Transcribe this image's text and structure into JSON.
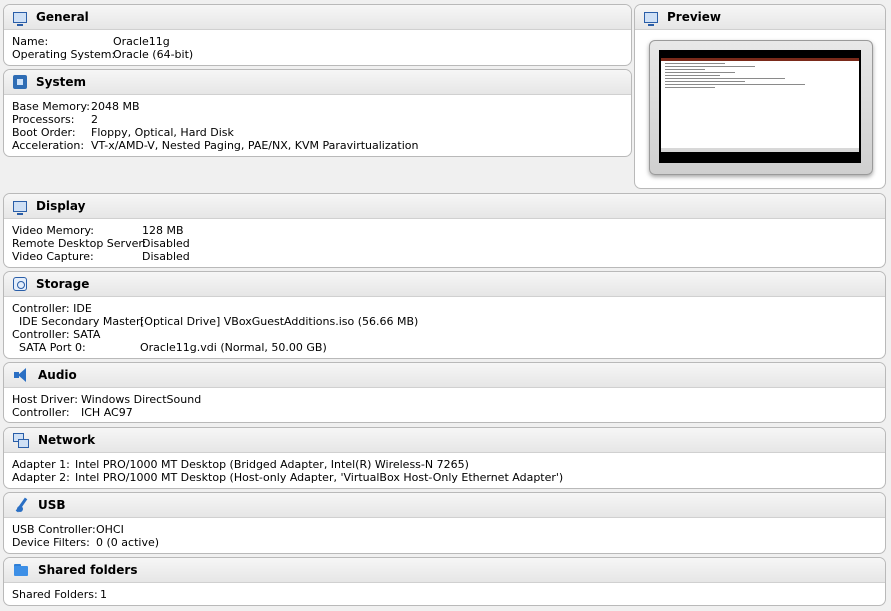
{
  "general": {
    "title": "General",
    "icon": "monitor-icon",
    "rows": [
      {
        "k": "Name:",
        "v": "Oracle11g"
      },
      {
        "k": "Operating System:",
        "v": "Oracle (64-bit)"
      }
    ]
  },
  "system": {
    "title": "System",
    "icon": "chip-icon",
    "rows": [
      {
        "k": "Base Memory:",
        "v": "2048 MB"
      },
      {
        "k": "Processors:",
        "v": "2"
      },
      {
        "k": "Boot Order:",
        "v": "Floppy, Optical, Hard Disk"
      },
      {
        "k": "Acceleration:",
        "v": "VT-x/AMD-V, Nested Paging, PAE/NX, KVM Paravirtualization"
      }
    ]
  },
  "preview": {
    "title": "Preview",
    "icon": "monitor-icon"
  },
  "display": {
    "title": "Display",
    "icon": "monitor-icon",
    "rows": [
      {
        "k": "Video Memory:",
        "v": "128 MB"
      },
      {
        "k": "Remote Desktop Server:",
        "v": "Disabled"
      },
      {
        "k": "Video Capture:",
        "v": "Disabled"
      }
    ]
  },
  "storage": {
    "title": "Storage",
    "icon": "disk-icon",
    "rows": [
      {
        "k": "Controller: IDE",
        "v": ""
      },
      {
        "k": "  IDE Secondary Master:",
        "v": "[Optical Drive] VBoxGuestAdditions.iso (56.66 MB)"
      },
      {
        "k": "Controller: SATA",
        "v": ""
      },
      {
        "k": "  SATA Port 0:",
        "v": "Oracle11g.vdi (Normal, 50.00 GB)"
      }
    ]
  },
  "audio": {
    "title": "Audio",
    "icon": "speaker-icon",
    "rows": [
      {
        "k": "Host Driver:",
        "v": "Windows DirectSound"
      },
      {
        "k": "Controller:",
        "v": "ICH AC97"
      }
    ]
  },
  "network": {
    "title": "Network",
    "icon": "network-icon",
    "rows": [
      {
        "k": "Adapter 1:",
        "v": "Intel PRO/1000 MT Desktop (Bridged Adapter, Intel(R) Wireless-N 7265)"
      },
      {
        "k": "Adapter 2:",
        "v": "Intel PRO/1000 MT Desktop (Host-only Adapter, 'VirtualBox Host-Only Ethernet Adapter')"
      }
    ]
  },
  "usb": {
    "title": "USB",
    "icon": "usb-icon",
    "rows": [
      {
        "k": "USB Controller:",
        "v": "OHCI"
      },
      {
        "k": "Device Filters:",
        "v": "0 (0 active)"
      }
    ]
  },
  "shared": {
    "title": "Shared folders",
    "icon": "folder-icon",
    "rows": [
      {
        "k": "Shared Folders:",
        "v": "1"
      }
    ]
  }
}
